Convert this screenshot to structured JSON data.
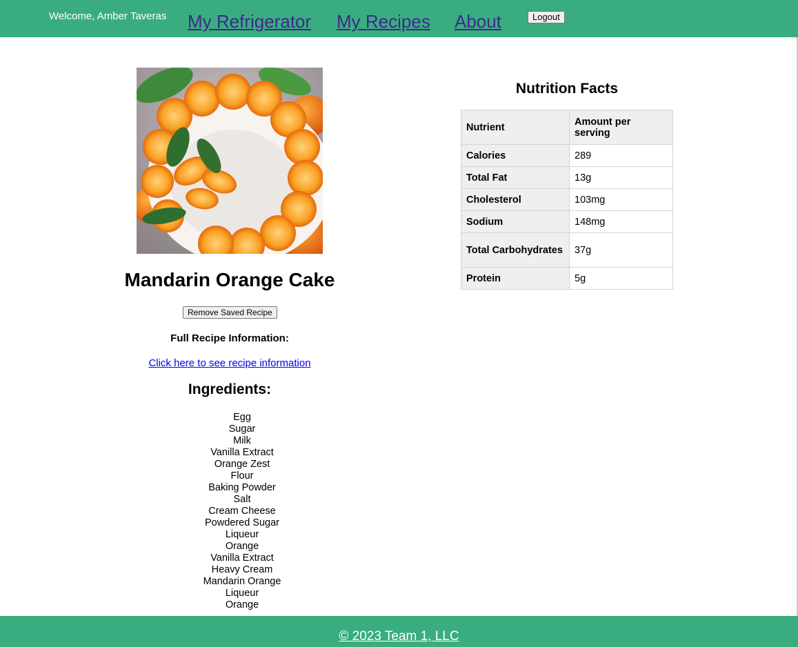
{
  "header": {
    "welcome": "Welcome, Amber Taveras",
    "nav": {
      "refrigerator": "My Refrigerator",
      "recipes": "My Recipes",
      "about": "About"
    },
    "logout_label": "Logout"
  },
  "recipe": {
    "title": "Mandarin Orange Cake",
    "remove_label": "Remove Saved Recipe",
    "full_info_label": "Full Recipe Information:",
    "info_link": "Click here to see recipe information",
    "ingredients_heading": "Ingredients:",
    "ingredients": [
      "Egg",
      "Sugar",
      "Milk",
      "Vanilla Extract",
      "Orange Zest",
      "Flour",
      "Baking Powder",
      "Salt",
      "Cream Cheese",
      "Powdered Sugar",
      "Liqueur",
      "Orange",
      "Vanilla Extract",
      "Heavy Cream",
      "Mandarin Orange",
      "Liqueur",
      "Orange"
    ]
  },
  "nutrition": {
    "heading": "Nutrition Facts",
    "col_nutrient": "Nutrient",
    "col_amount": "Amount per serving",
    "rows": [
      {
        "nutrient": "Calories",
        "amount": "289"
      },
      {
        "nutrient": "Total Fat",
        "amount": "13g"
      },
      {
        "nutrient": "Cholesterol",
        "amount": "103mg"
      },
      {
        "nutrient": "Sodium",
        "amount": "148mg"
      },
      {
        "nutrient": "Total Carbohydrates",
        "amount": "37g"
      },
      {
        "nutrient": "Protein",
        "amount": "5g"
      }
    ]
  },
  "footer": {
    "copyright": "© 2023 Team 1, LLC"
  },
  "colors": {
    "brand_green": "#3aad80",
    "nav_link": "#3b2a8c",
    "link_blue": "#0000ee"
  }
}
